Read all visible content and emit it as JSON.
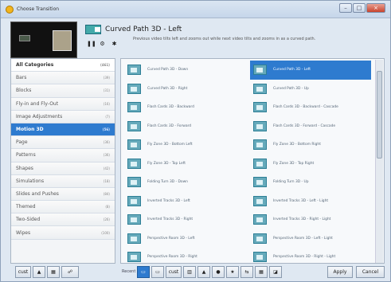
{
  "window": {
    "title": "Choose Transition",
    "buttons": [
      "–",
      "□",
      "×"
    ]
  },
  "header": {
    "title": "Curved Path 3D - Left",
    "description": "Previous video tilts left and zooms out while next video tilts and zooms in as a curved path.",
    "playback": [
      "❚❚",
      "⚙",
      "✱"
    ]
  },
  "categories": [
    {
      "label": "All Categories",
      "count": "(461)",
      "state": "all"
    },
    {
      "label": "Bars",
      "count": "(39)"
    },
    {
      "label": "Blocks",
      "count": "(31)"
    },
    {
      "label": "Fly-in and Fly-Out",
      "count": "(16)"
    },
    {
      "label": "Image Adjustments",
      "count": "(7)"
    },
    {
      "label": "Motion 3D",
      "count": "(56)",
      "state": "selected"
    },
    {
      "label": "Page",
      "count": "(36)"
    },
    {
      "label": "Patterns",
      "count": "(36)"
    },
    {
      "label": "Shapes",
      "count": "(42)"
    },
    {
      "label": "Simulations",
      "count": "(18)"
    },
    {
      "label": "Slides and Pushes",
      "count": "(84)"
    },
    {
      "label": "Themed",
      "count": "(8)"
    },
    {
      "label": "Two-Sided",
      "count": "(26)"
    },
    {
      "label": "Wipes",
      "count": "(100)"
    }
  ],
  "transitions": [
    {
      "label": "Curved Path 3D - Down"
    },
    {
      "label": "Curved Path 3D - Left",
      "state": "selected"
    },
    {
      "label": "Curved Path 3D - Right"
    },
    {
      "label": "Curved Path 3D - Up"
    },
    {
      "label": "Flash Cards 3D - Backward"
    },
    {
      "label": "Flash Cards 3D - Backward - Cascade"
    },
    {
      "label": "Flash Cards 3D - Forward"
    },
    {
      "label": "Flash Cards 3D - Forward - Cascade"
    },
    {
      "label": "Fly Zone 3D - Bottom Left"
    },
    {
      "label": "Fly Zone 3D - Bottom Right"
    },
    {
      "label": "Fly Zone 3D - Top Left"
    },
    {
      "label": "Fly Zone 3D - Top Right"
    },
    {
      "label": "Folding Turn 3D - Down"
    },
    {
      "label": "Folding Turn 3D - Up"
    },
    {
      "label": "Inverted Tracks 3D - Left"
    },
    {
      "label": "Inverted Tracks 3D - Left - Light"
    },
    {
      "label": "Inverted Tracks 3D - Right"
    },
    {
      "label": "Inverted Tracks 3D - Right - Light"
    },
    {
      "label": "Perspective Room 3D - Left"
    },
    {
      "label": "Perspective Room 3D - Left - Light"
    },
    {
      "label": "Perspective Room 3D - Right"
    },
    {
      "label": "Perspective Room 3D - Right - Light"
    }
  ],
  "bottom": {
    "left_tools": [
      "cust",
      "▲",
      "▦",
      "☍"
    ],
    "recent_label": "Recent",
    "recent_tools": [
      "▭",
      "▭",
      "cust",
      "▥",
      "▲",
      "●",
      "★",
      "⇆",
      "▦",
      "◪"
    ],
    "apply_label": "Apply",
    "cancel_label": "Cancel"
  },
  "colors": {
    "accent": "#2e7bcf",
    "panel_border": "#a9b5c4"
  }
}
